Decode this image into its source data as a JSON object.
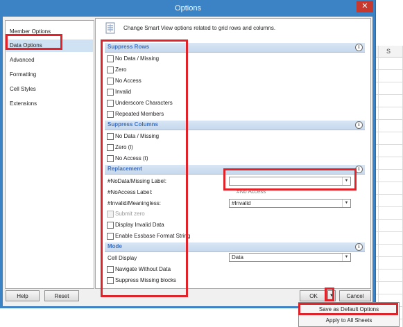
{
  "window": {
    "title": "Options",
    "close_glyph": "✕",
    "close_icon": "close-icon"
  },
  "background": {
    "column_header": "S"
  },
  "nav": {
    "items": [
      {
        "label": "Member Options"
      },
      {
        "label": "Data Options",
        "selected": true
      },
      {
        "label": "Advanced"
      },
      {
        "label": "Formatting"
      },
      {
        "label": "Cell Styles"
      },
      {
        "label": "Extensions"
      }
    ]
  },
  "header": {
    "text": "Change Smart View options related to grid rows and columns.",
    "icon": "document-icon"
  },
  "info_glyph": "i",
  "sections": {
    "suppress_rows": {
      "title": "Suppress Rows",
      "items": [
        {
          "label": "No Data / Missing",
          "checked": false
        },
        {
          "label": "Zero",
          "checked": false
        },
        {
          "label": "No Access",
          "checked": false
        },
        {
          "label": "Invalid",
          "checked": false
        },
        {
          "label": "Underscore Characters",
          "checked": false
        },
        {
          "label": "Repeated Members",
          "checked": false
        }
      ]
    },
    "suppress_columns": {
      "title": "Suppress Columns",
      "items": [
        {
          "label": "No Data / Missing",
          "checked": false
        },
        {
          "label": "Zero (l)",
          "checked": false
        },
        {
          "label": "No Access (t)",
          "checked": false
        }
      ]
    },
    "replacement": {
      "title": "Replacement",
      "nodata_label": "#NoData/Missing Label:",
      "nodata_value": "",
      "noaccess_label": "#NoAccess Label:",
      "noaccess_value": "#No Access",
      "invalid_label": "#Invalid/Meaningless:",
      "invalid_value": "#Invalid",
      "items": [
        {
          "label": "Submit zero",
          "checked": false,
          "disabled": true
        },
        {
          "label": "Display Invalid Data",
          "checked": false
        },
        {
          "label": "Enable Essbase Format String",
          "checked": false
        }
      ]
    },
    "mode": {
      "title": "Mode",
      "cell_display_label": "Cell Display",
      "cell_display_value": "Data",
      "items": [
        {
          "label": "Navigate Without Data",
          "checked": false
        },
        {
          "label": "Suppress Missing blocks",
          "checked": false
        }
      ]
    }
  },
  "buttons": {
    "help": "Help",
    "reset": "Reset",
    "ok": "OK",
    "cancel": "Cancel",
    "dropdown_glyph": "▼"
  },
  "ok_menu": {
    "items": [
      {
        "label": "Save as Default Options",
        "highlighted": true
      },
      {
        "label": "Apply to All Sheets",
        "highlighted": false
      }
    ]
  },
  "colors": {
    "titlebar": "#3c83c6",
    "annotation": "#e0222b",
    "section_text": "#3b6fc0",
    "selected_nav": "#cfe2f3"
  }
}
